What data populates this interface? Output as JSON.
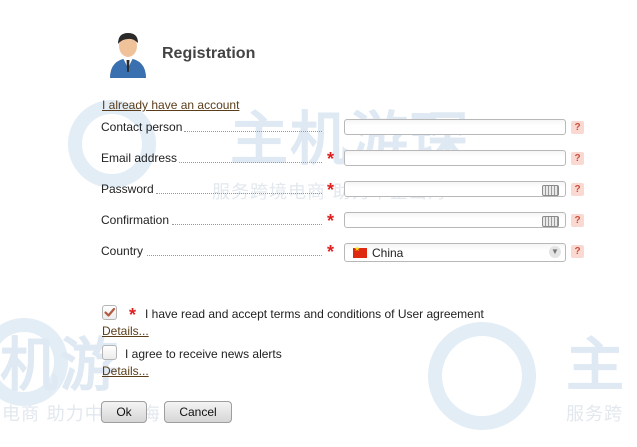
{
  "header": {
    "title": "Registration",
    "avatar_icon": "user-avatar-icon"
  },
  "links": {
    "already_have_account": "I already have an account"
  },
  "form": {
    "contact_person": {
      "label": "Contact person",
      "value": "",
      "required": false
    },
    "email": {
      "label": "Email address",
      "value": "",
      "required": true
    },
    "password": {
      "label": "Password",
      "value": "",
      "required": true
    },
    "confirmation": {
      "label": "Confirmation",
      "value": "",
      "required": true
    },
    "country": {
      "label": "Country",
      "selected": "China",
      "required": true
    },
    "required_mark": "*",
    "help_mark": "?"
  },
  "agreements": {
    "terms": {
      "label": "I have read and accept terms and conditions of User agreement",
      "checked": true,
      "details": "Details..."
    },
    "news": {
      "label": "I agree to receive news alerts",
      "checked": false,
      "details": "Details..."
    }
  },
  "buttons": {
    "ok": "Ok",
    "cancel": "Cancel"
  },
  "watermark": {
    "brand_top": "主机游琛",
    "slogan": "服务跨境电商 助力中企出海",
    "brand_left": "机游",
    "slogan_left": "电商 助力中企出海",
    "brand_right": "主",
    "slogan_right": "服务跨"
  },
  "colors": {
    "required": "#e02020",
    "link": "#5a3d1a",
    "help_bg": "#fbd9d3",
    "watermark": "#dfe9f3"
  }
}
